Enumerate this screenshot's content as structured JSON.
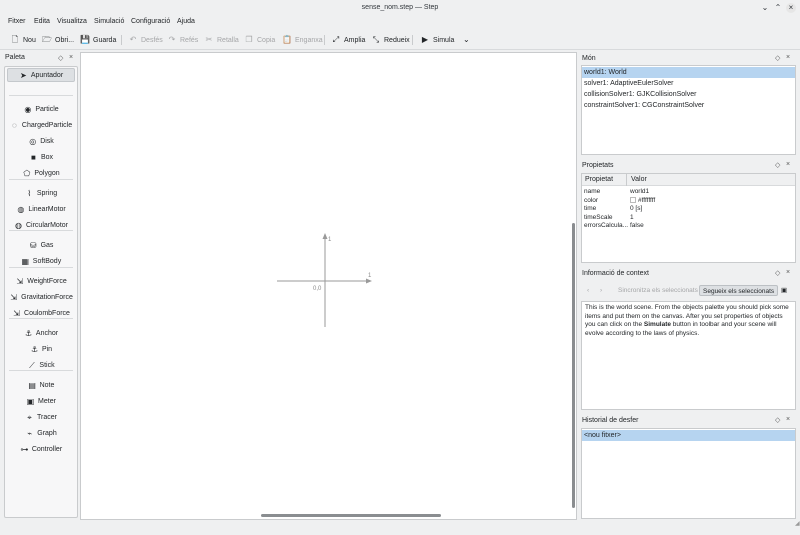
{
  "window": {
    "title": "sense_nom.step — Step",
    "minimize_glyph": "⌄",
    "maximize_glyph": "⌃",
    "close_glyph": "×"
  },
  "menu": [
    "Fitxer",
    "Edita",
    "Visualitza",
    "Simulació",
    "Configuració",
    "Ajuda"
  ],
  "toolbar": {
    "new": "Nou",
    "open": "Obri...",
    "save": "Guarda",
    "undo": "Desfés",
    "redo": "Refés",
    "cut": "Retalla",
    "copy": "Copia",
    "paste": "Enganxa",
    "zoom_in": "Amplia",
    "zoom_out": "Redueix",
    "simulate": "Simula"
  },
  "palette": {
    "title": "Paleta",
    "items": [
      {
        "label": "Apuntador",
        "icon": "pointer-icon",
        "glyph": "➤",
        "selected": true
      },
      {
        "label": "Particle",
        "icon": "particle-icon",
        "glyph": "◉"
      },
      {
        "label": "ChargedParticle",
        "icon": "charged-particle-icon",
        "glyph": "◌"
      },
      {
        "label": "Disk",
        "icon": "disk-icon",
        "glyph": "◎"
      },
      {
        "label": "Box",
        "icon": "box-icon",
        "glyph": "■"
      },
      {
        "label": "Polygon",
        "icon": "polygon-icon",
        "glyph": "⬠"
      },
      {
        "label": "Spring",
        "icon": "spring-icon",
        "glyph": "⌇"
      },
      {
        "label": "LinearMotor",
        "icon": "linear-motor-icon",
        "glyph": "◍"
      },
      {
        "label": "CircularMotor",
        "icon": "circular-motor-icon",
        "glyph": "◍"
      },
      {
        "label": "Gas",
        "icon": "gas-icon",
        "glyph": "⛁"
      },
      {
        "label": "SoftBody",
        "icon": "soft-body-icon",
        "glyph": "▦"
      },
      {
        "label": "WeightForce",
        "icon": "weight-force-icon",
        "glyph": "⇲"
      },
      {
        "label": "GravitationForce",
        "icon": "gravitation-force-icon",
        "glyph": "⇲"
      },
      {
        "label": "CoulombForce",
        "icon": "coulomb-force-icon",
        "glyph": "⇲"
      },
      {
        "label": "Anchor",
        "icon": "anchor-icon",
        "glyph": "⚓"
      },
      {
        "label": "Pin",
        "icon": "pin-icon",
        "glyph": "⚓"
      },
      {
        "label": "Stick",
        "icon": "stick-icon",
        "glyph": "⟋"
      },
      {
        "label": "Note",
        "icon": "note-icon",
        "glyph": "▤"
      },
      {
        "label": "Meter",
        "icon": "meter-icon",
        "glyph": "▣"
      },
      {
        "label": "Tracer",
        "icon": "tracer-icon",
        "glyph": "⌖"
      },
      {
        "label": "Graph",
        "icon": "graph-icon",
        "glyph": "⌁"
      },
      {
        "label": "Controller",
        "icon": "controller-icon",
        "glyph": "⊶"
      }
    ]
  },
  "canvas": {
    "axis_y_label": "1",
    "axis_x_label": "1",
    "origin_label": "0,0"
  },
  "world_dock": {
    "title": "Món",
    "items": [
      {
        "label": "world1: World",
        "selected": true
      },
      {
        "label": "solver1: AdaptiveEulerSolver"
      },
      {
        "label": "collisionSolver1: GJKCollisionSolver"
      },
      {
        "label": "constraintSolver1: CGConstraintSolver"
      }
    ]
  },
  "properties_dock": {
    "title": "Propietats",
    "col_property": "Propietat",
    "col_value": "Valor",
    "rows": [
      {
        "key": "name",
        "value": "world1"
      },
      {
        "key": "color",
        "value": "#ffffffff",
        "swatch": "#ffffff"
      },
      {
        "key": "time",
        "value": "0 [s]"
      },
      {
        "key": "timeScale",
        "value": "1"
      },
      {
        "key": "errorsCalcula...",
        "value": "false"
      }
    ]
  },
  "context_dock": {
    "title": "Informació de context",
    "sync_label": "Sincronitza els seleccionats",
    "follow_label": "Segueix els seleccionats",
    "text_pre": "This is the world scene. From the objects palette you should pick some items and put them on the canvas. After you set properties of objects you can click on the ",
    "text_bold": "Simulate",
    "text_post": " button in toolbar and your scene will evolve according to the laws of physics."
  },
  "undo_dock": {
    "title": "Historial de desfer",
    "items": [
      {
        "label": "<nou fitxer>",
        "selected": true
      }
    ]
  },
  "colors": {
    "selection": "#b6d4f0",
    "window_bg": "#eff0f1",
    "canvas_bg": "#ffffff"
  }
}
